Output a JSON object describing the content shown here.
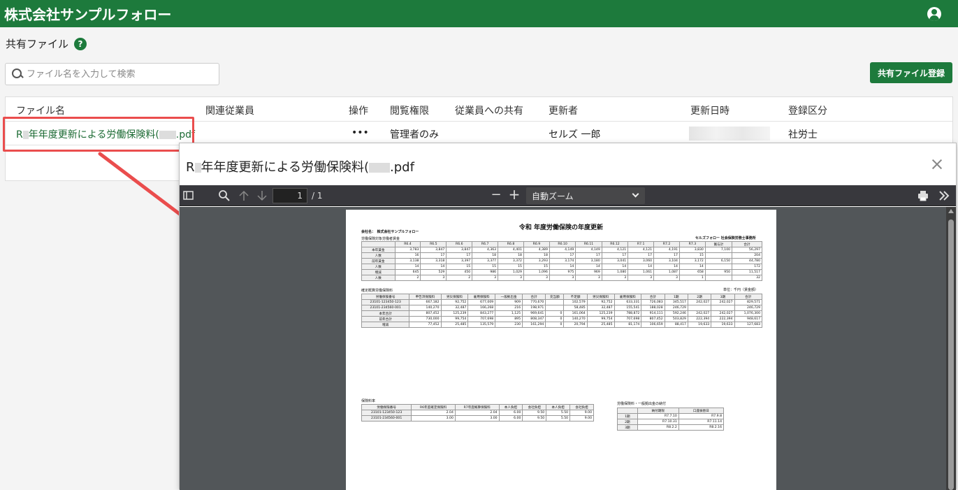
{
  "app": {
    "company_name": "株式会社サンプルフォロー"
  },
  "page": {
    "title": "共有ファイル",
    "help_label": "?"
  },
  "search": {
    "placeholder": "ファイル名を入力して検索"
  },
  "register_button": "共有ファイル登録",
  "table": {
    "columns": [
      "ファイル名",
      "関連従業員",
      "操作",
      "閲覧権限",
      "従業員への共有",
      "更新者",
      "更新日時",
      "登録区分"
    ],
    "rows": [
      {
        "file_name_prefix": "R",
        "file_name_mid": "年年度更新による労働保険料(",
        "file_name_suffix": ".pdf",
        "employee": "",
        "action": "•••",
        "permission": "管理者のみ",
        "shared": "",
        "updater": "セルズ 一郎",
        "category": "社労士"
      }
    ]
  },
  "viewer": {
    "title_prefix": "R",
    "title_mid": "年年度更新による労働保険料(",
    "title_suffix": ".pdf",
    "toolbar": {
      "page_current": "1",
      "page_total": "/ 1",
      "zoom": "自動ズーム",
      "minus": "−",
      "plus": "+"
    },
    "pdf": {
      "title": "令和 年度労働保険の年度更新",
      "company_label": "会社名：　株式会社サンプルフォロー",
      "office": "セルズフォロー 社会保険労務士事務所",
      "section1": "労働保険対象労働者賃金",
      "section2": "確定概算労働保険料",
      "unit": "単位：千円（賃金額）",
      "section3": "保険料率",
      "section4": "労働保険料・一般拠出金の納付",
      "wage_table": {
        "header": [
          "",
          "R6.4",
          "R6.5",
          "R6.6",
          "R6.7",
          "R6.8",
          "R6.9",
          "R6.10",
          "R6.11",
          "R6.12",
          "R7.1",
          "R7.2",
          "R7.3",
          "賞与計",
          "合計"
        ],
        "rows": [
          [
            "本年賃金",
            "3,783",
            "3,847",
            "3,847",
            "4,363",
            "4,401",
            "4,389",
            "4,149",
            "4,149",
            "4,121",
            "4,121",
            "4,191",
            "3,830",
            "7,100",
            "56,297"
          ],
          [
            "人数",
            "16",
            "17",
            "17",
            "18",
            "18",
            "18",
            "17",
            "17",
            "17",
            "17",
            "17",
            "15",
            "",
            "204"
          ],
          [
            "前年賃金",
            "3,138",
            "3,318",
            "3,397",
            "3,377",
            "3,372",
            "3,293",
            "3,174",
            "3,180",
            "3,041",
            "3,060",
            "3,104",
            "3,172",
            "6,150",
            "44,780"
          ],
          [
            "人数",
            "14",
            "14",
            "15",
            "15",
            "15",
            "15",
            "14",
            "14",
            "14",
            "14",
            "14",
            "14",
            "",
            "172"
          ],
          [
            "増減",
            "645",
            "529",
            "450",
            "986",
            "1,029",
            "1,096",
            "975",
            "969",
            "1,080",
            "1,061",
            "1,087",
            "658",
            "950",
            "11,517"
          ],
          [
            "人数",
            "2",
            "3",
            "2",
            "3",
            "3",
            "3",
            "3",
            "3",
            "3",
            "3",
            "3",
            "1",
            "",
            "32"
          ]
        ]
      },
      "premium_table": {
        "header": [
          "労働保険番号",
          "申告済保険料",
          "労災保険料",
          "雇用保険料",
          "一般拠出金",
          "合計",
          "充当額",
          "不足額",
          "労災保険料",
          "雇用保険料",
          "合計",
          "1期",
          "2期",
          "3期",
          "合計"
        ],
        "rows": [
          [
            "23101-123450-123",
            "667,182",
            "92,752",
            "677,009",
            "909",
            "770,670",
            "",
            "102,579",
            "92,752",
            "633,331",
            "726,083",
            "345,517",
            "242,027",
            "242,027",
            "829,571"
          ],
          [
            "23101-234560-001",
            "140,270",
            "32,487",
            "166,268",
            "216",
            "198,971",
            "",
            "58,485",
            "32,487",
            "155,541",
            "188,028",
            "246,729",
            "",
            "",
            "246,729"
          ],
          [
            "本年合計",
            "807,452",
            "125,239",
            "843,277",
            "1,125",
            "969,641",
            "0",
            "161,064",
            "125,239",
            "788,872",
            "914,111",
            "592,246",
            "242,027",
            "242,027",
            "1,076,300"
          ],
          [
            "前年合計",
            "730,000",
            "99,754",
            "707,698",
            "895",
            "808,347",
            "0",
            "140,270",
            "99,754",
            "707,698",
            "807,452",
            "503,829",
            "222,394",
            "222,394",
            "948,617"
          ],
          [
            "増減",
            "77,452",
            "25,485",
            "135,579",
            "230",
            "161,294",
            "0",
            "20,794",
            "25,485",
            "81,174",
            "106,659",
            "88,417",
            "19,633",
            "19,633",
            "127,683"
          ]
        ]
      },
      "rate_table": {
        "header": [
          "労働保険番号",
          "R6年度確定保険料",
          "R7年度概算保険料",
          "本人負担",
          "会社負担",
          "本人負担",
          "会社負担"
        ],
        "rows": [
          [
            "23101-123450-123",
            "2.04",
            "2.04",
            "6.00",
            "9.50",
            "5.50",
            "9.00"
          ],
          [
            "23101-234560-001",
            "3.00",
            "3.00",
            "6.00",
            "9.50",
            "5.50",
            "9.00"
          ]
        ]
      },
      "payment_table": {
        "header": [
          "",
          "納付期限",
          "口座振替日"
        ],
        "rows": [
          [
            "1期",
            "R7.7.10",
            "R7.9.8"
          ],
          [
            "2期",
            "R7.10.31",
            "R7.11.14"
          ],
          [
            "3期",
            "R8.2.2",
            "R8.2.16"
          ]
        ]
      }
    }
  },
  "colors": {
    "brand": "#1d7a3c",
    "highlight": "#ea4d4d"
  }
}
